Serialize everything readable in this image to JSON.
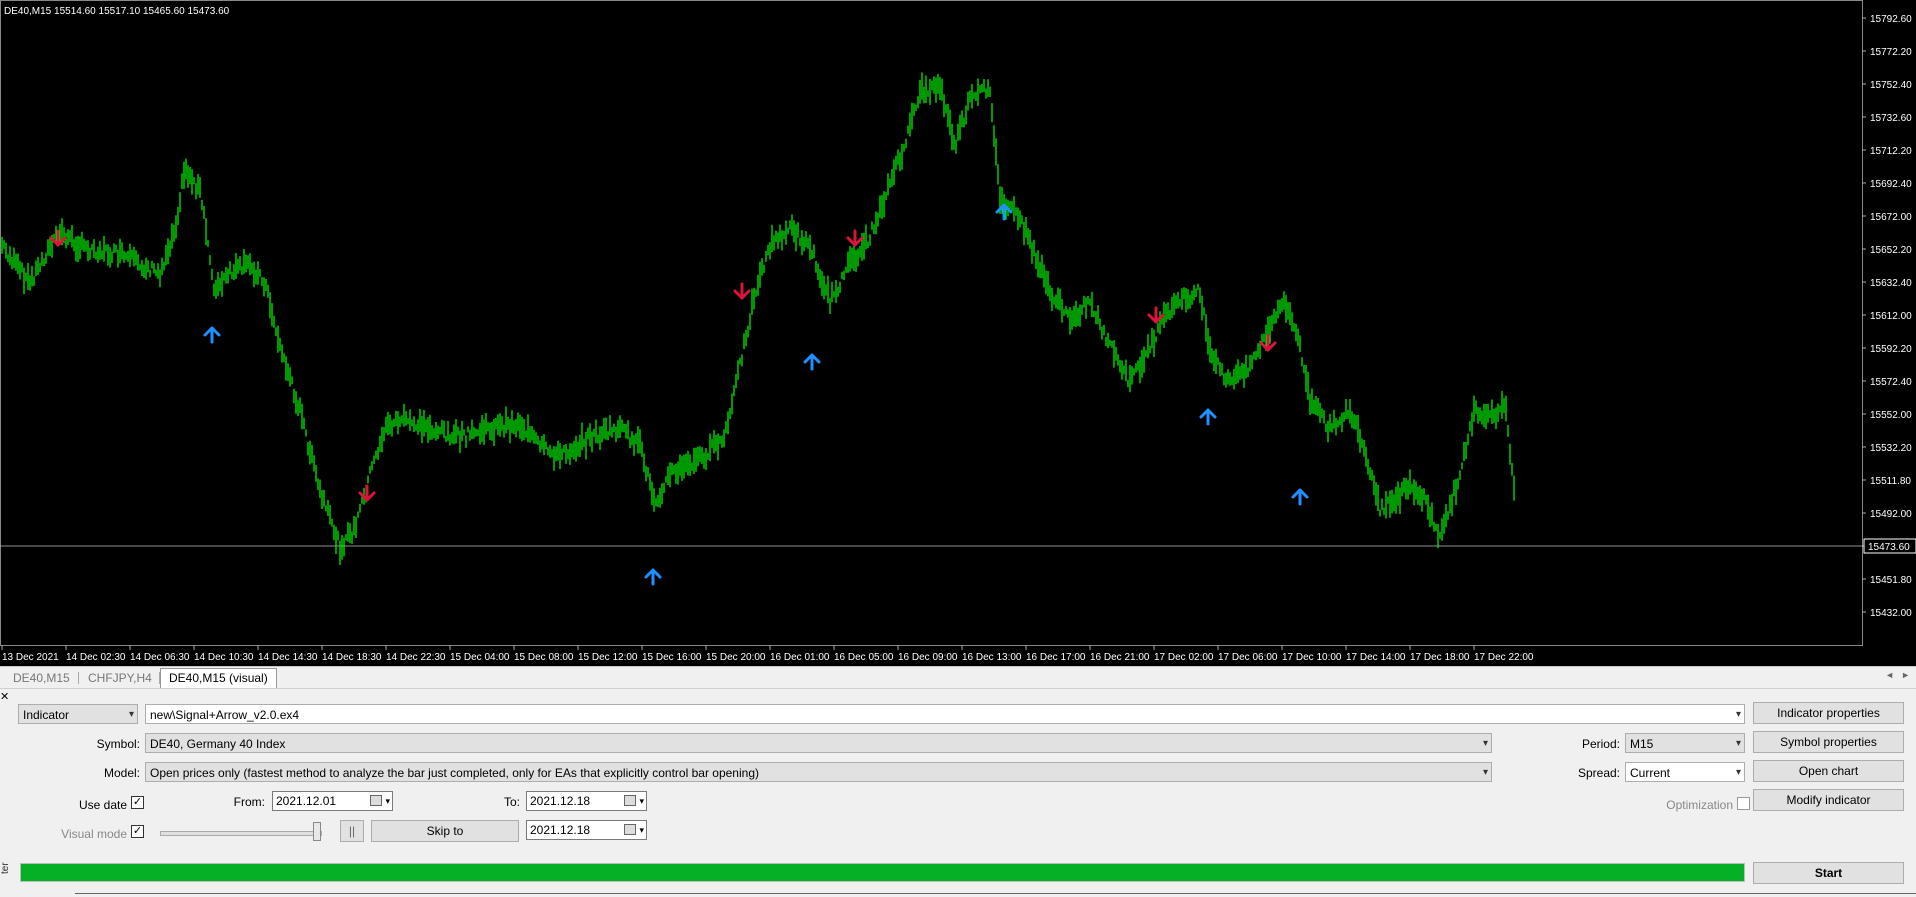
{
  "chart": {
    "header": "DE40,M15  15514.60 15517.10 15465.60 15473.60",
    "current_price": "15473.60",
    "price_labels": [
      "15792.60",
      "15772.20",
      "15752.40",
      "15732.60",
      "15712.20",
      "15692.40",
      "15672.00",
      "15652.20",
      "15632.40",
      "15612.00",
      "15592.20",
      "15572.40",
      "15552.00",
      "15532.20",
      "15511.80",
      "15492.00",
      "15473.60",
      "15451.80",
      "15432.00"
    ],
    "time_labels": [
      "13 Dec 2021",
      "14 Dec 02:30",
      "14 Dec 06:30",
      "14 Dec 10:30",
      "14 Dec 14:30",
      "14 Dec 18:30",
      "14 Dec 22:30",
      "15 Dec 04:00",
      "15 Dec 08:00",
      "15 Dec 12:00",
      "15 Dec 16:00",
      "15 Dec 20:00",
      "16 Dec 01:00",
      "16 Dec 05:00",
      "16 Dec 09:00",
      "16 Dec 13:00",
      "16 Dec 17:00",
      "16 Dec 21:00",
      "17 Dec 02:00",
      "17 Dec 06:00",
      "17 Dec 10:00",
      "17 Dec 14:00",
      "17 Dec 18:00",
      "17 Dec 22:00"
    ],
    "colors": {
      "background": "#000000",
      "candle": "#00ff00",
      "arrow_up": "#1e90ff",
      "arrow_down": "#dc143c",
      "grid_line": "#c0c0c0"
    }
  },
  "tabs": [
    {
      "label": "DE40,M15",
      "active": false
    },
    {
      "label": "CHFJPY,H4",
      "active": false
    },
    {
      "label": "DE40,M15 (visual)",
      "active": true
    }
  ],
  "tester": {
    "type_value": "Indicator",
    "expert_path": "new\\Signal+Arrow_v2.0.ex4",
    "symbol_label": "Symbol:",
    "symbol_value": "DE40, Germany 40 Index",
    "model_label": "Model:",
    "model_value": "Open prices only (fastest method to analyze the bar just completed, only for EAs that explicitly control bar opening)",
    "use_date_label": "Use date",
    "from_label": "From:",
    "from_value": "2021.12.01",
    "to_label": "To:",
    "to_value": "2021.12.18",
    "visual_mode_label": "Visual mode",
    "pause_label": "||",
    "skip_to_label": "Skip to",
    "skip_to_value": "2021.12.18",
    "period_label": "Period:",
    "period_value": "M15",
    "spread_label": "Spread:",
    "spread_value": "Current",
    "optimization_label": "Optimization",
    "buttons": {
      "indicator_properties": "Indicator properties",
      "symbol_properties": "Symbol properties",
      "open_chart": "Open chart",
      "modify_indicator": "Modify indicator",
      "start": "Start"
    },
    "progress_percent": 100,
    "side_label": "ter"
  }
}
